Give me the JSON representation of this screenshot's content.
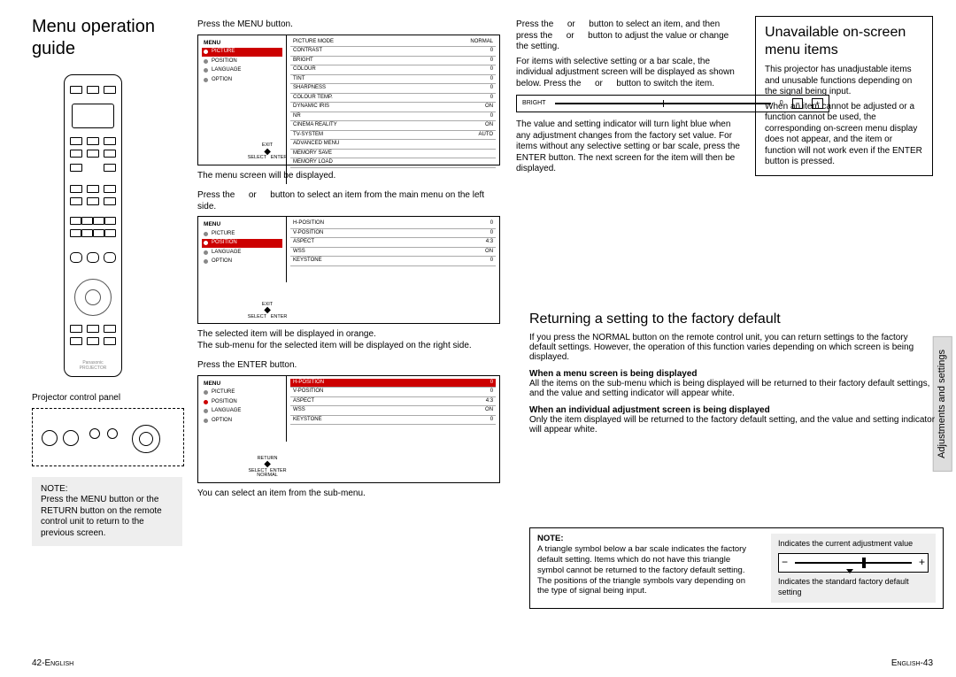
{
  "header": {
    "title": "Menu operation guide"
  },
  "col1": {
    "panel_caption": "Projector control panel",
    "note_label": "NOTE:",
    "note_text": "Press the MENU button or the RETURN button on the remote control unit to return to the previous screen.",
    "remote_label": "PROJECTOR",
    "remote_brand": "Panasonic"
  },
  "steps": {
    "s1": {
      "title": "Press the MENU button.",
      "after": "The menu screen will be displayed."
    },
    "s2": {
      "title": "Press the   or   button to select an item from the main menu on the left side.",
      "after1": "The selected item will be displayed in orange.",
      "after2": "The sub-menu for the selected item will be displayed on the right side."
    },
    "s3": {
      "title": "Press the ENTER button.",
      "after": "You can select an item from the sub-menu."
    },
    "s4": {
      "title": "Press the   or   button to select an item, and then press the   or   button to adjust the value or change the setting.",
      "after1": "For items with selective setting or a bar scale, the individual adjustment screen will be displayed as shown below. Press the   or   button to switch the item.",
      "after2": "The value and setting indicator will turn light blue when any adjustment changes from the factory set value. For items without any selective setting or bar scale, press the ENTER button. The next screen for the item will then be displayed."
    }
  },
  "menu": {
    "header": "MENU",
    "items": [
      "PICTURE",
      "POSITION",
      "LANGUAGE",
      "OPTION"
    ],
    "sub_picture": [
      [
        "PICTURE MODE",
        "NORMAL"
      ],
      [
        "CONTRAST",
        "0"
      ],
      [
        "BRIGHT",
        "0"
      ],
      [
        "COLOUR",
        "0"
      ],
      [
        "TINT",
        "0"
      ],
      [
        "SHARPNESS",
        "0"
      ],
      [
        "COLOUR TEMP.",
        "0"
      ],
      [
        "DYNAMIC IRIS",
        "ON"
      ],
      [
        "NR",
        "0"
      ],
      [
        "CINEMA REALITY",
        "ON"
      ],
      [
        "TV-SYSTEM",
        "AUTO"
      ],
      [
        "ADVANCED MENU",
        ""
      ],
      [
        "MEMORY SAVE",
        ""
      ],
      [
        "MEMORY LOAD",
        ""
      ]
    ],
    "sub_position": [
      [
        "H-POSITION",
        "0"
      ],
      [
        "V-POSITION",
        "0"
      ],
      [
        "ASPECT",
        "4:3"
      ],
      [
        "WSS",
        "ON"
      ],
      [
        "KEYSTONE",
        "0"
      ]
    ],
    "nav": {
      "exit": "EXIT",
      "select": "SELECT",
      "enter": "ENTER",
      "return": "RETURN",
      "normal": "NORMAL"
    }
  },
  "bright_bar": {
    "label": "BRIGHT",
    "value": "0"
  },
  "returning": {
    "title": "Returning a setting to the factory default",
    "intro": "If you press the NORMAL button on the remote control unit, you can return settings to the factory default settings. However, the operation of this function varies depending on which screen is being displayed.",
    "h1": "When a menu screen is being displayed",
    "p1": "All the items on the sub-menu which is being displayed will be returned to their factory default settings, and the value and setting indicator will appear white.",
    "h2": "When an individual adjustment screen is being displayed",
    "p2": "Only the item displayed will be returned to the factory default setting, and the value and setting indicator will appear white."
  },
  "factory_note": {
    "label": "NOTE:",
    "text": "A triangle symbol below a bar scale indicates the factory default setting. Items which do not have this triangle symbol cannot be returned to the factory default setting. The positions of the triangle symbols vary depending on the type of signal being input.",
    "ind_current": "Indicates the current adjustment value",
    "ind_standard": "Indicates the standard factory default setting"
  },
  "unavailable": {
    "title": "Unavailable on-screen menu items",
    "p1": "This projector has unadjustable items and unusable functions depending on the signal being input.",
    "p2": "When an item cannot be adjusted or a function cannot be used, the corresponding on-screen menu display does not appear, and the item or function will not work even if the ENTER button is pressed."
  },
  "sidetab": "Adjustments and settings",
  "footer": {
    "left_num": "42-",
    "left_word": "English",
    "right_word": "English",
    "right_num": "-43"
  }
}
